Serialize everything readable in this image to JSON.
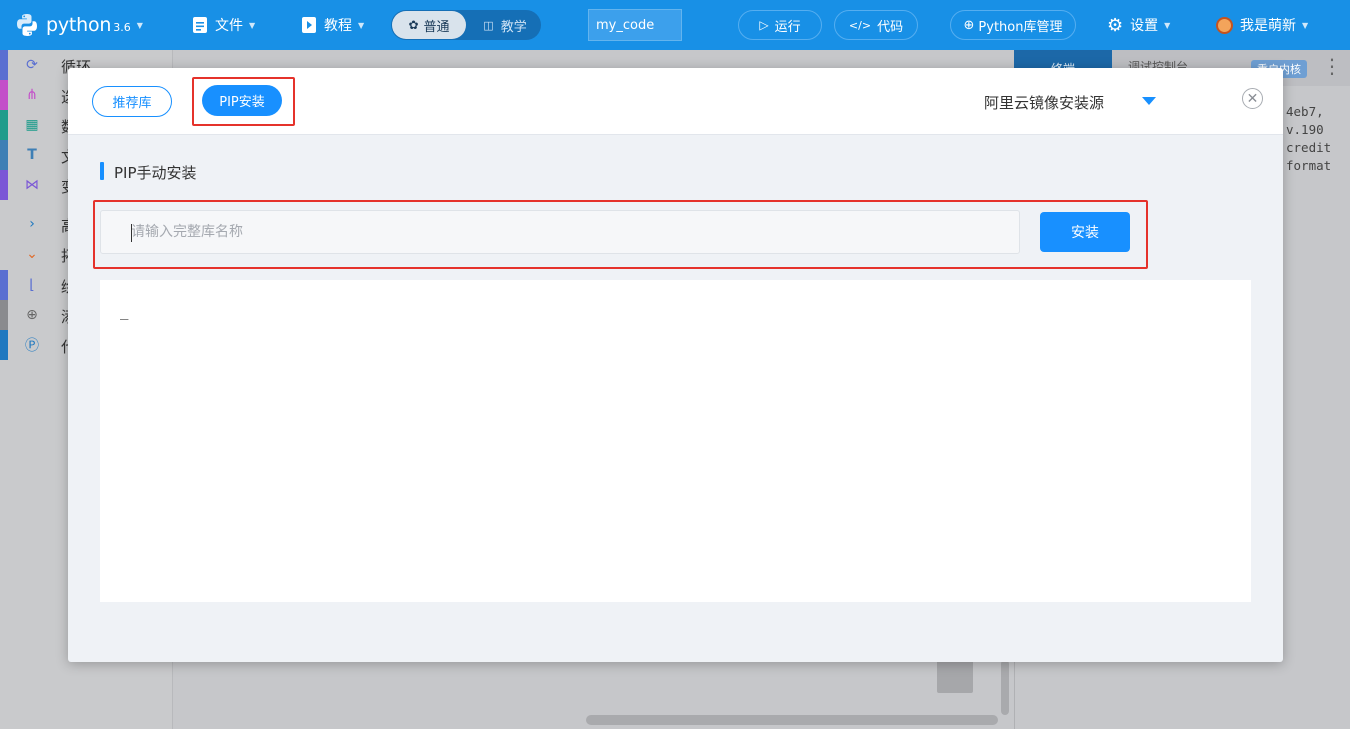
{
  "topbar": {
    "logo_text": "python",
    "logo_version": "3.6",
    "menu_file": "文件",
    "menu_tutorial": "教程",
    "mode_normal": "普通",
    "mode_teach": "教学",
    "filename": "my_code",
    "run_label": "运行",
    "code_label": "代码",
    "pkg_label": "Python库管理",
    "settings_label": "设置",
    "user_label": "我是萌新",
    "accent": "#1890e6"
  },
  "sidebar": {
    "items": [
      {
        "label": "循环",
        "icon": "loop-icon",
        "color": "#5a6fd1"
      },
      {
        "label": "选",
        "icon": "branch-icon",
        "color": "#c34ec9"
      },
      {
        "label": "数",
        "icon": "calc-icon",
        "color": "#1e9c8b"
      },
      {
        "label": "文",
        "icon": "text-icon",
        "color": "#3e7fb5"
      },
      {
        "label": "变",
        "icon": "variable-icon",
        "color": "#7b56d6"
      },
      {
        "label": "高",
        "icon": "chevron-right-icon",
        "color": "#c9cacc"
      },
      {
        "label": "拓",
        "icon": "chevron-down-icon",
        "color": "#c9cacc"
      },
      {
        "label": "绘",
        "icon": "chart-icon",
        "color": "#5a6fd1"
      },
      {
        "label": "添",
        "icon": "plus-circle-icon",
        "color": "#8a8b8e"
      },
      {
        "label": "代",
        "icon": "p-circle-icon",
        "color": "#1e78c0"
      }
    ]
  },
  "right_panel": {
    "tab_active": "终端",
    "tab_second": "调试控制台",
    "badge": "重启内核",
    "console_lines": [
      "4eb7,",
      "v.190",
      "",
      "credit",
      "format"
    ]
  },
  "modal": {
    "tab_recommended": "推荐库",
    "tab_pip": "PIP安装",
    "mirror_source": "阿里云镜像安装源",
    "section_title": "PIP手动安装",
    "input_placeholder": "请输入完整库名称",
    "install_button": "安装",
    "output_text": "_",
    "accent": "#1890ff",
    "highlight_color": "#e5322b"
  }
}
